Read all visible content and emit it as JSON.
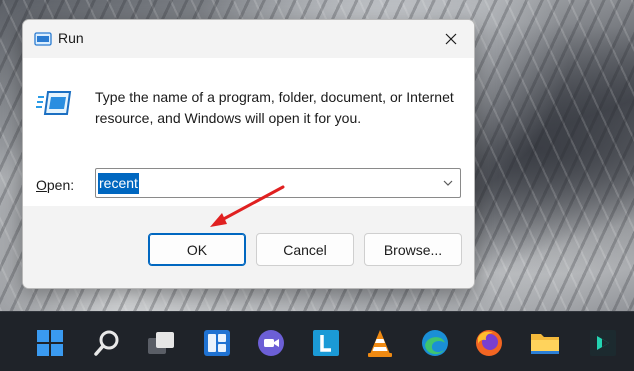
{
  "dialog": {
    "title": "Run",
    "description": "Type the name of a program, folder, document, or Internet resource, and Windows will open it for you.",
    "open_label_first": "O",
    "open_label_rest": "pen:",
    "input_value": "recent",
    "buttons": {
      "ok": "OK",
      "cancel": "Cancel",
      "browse": "Browse..."
    }
  },
  "taskbar": {
    "items": [
      {
        "icon": "windows-start-icon"
      },
      {
        "icon": "search-icon"
      },
      {
        "icon": "task-view-icon"
      },
      {
        "icon": "widgets-icon"
      },
      {
        "icon": "teams-chat-icon"
      },
      {
        "icon": "app-l-icon"
      },
      {
        "icon": "vlc-icon"
      },
      {
        "icon": "edge-icon"
      },
      {
        "icon": "firefox-icon"
      },
      {
        "icon": "file-explorer-icon"
      },
      {
        "icon": "filmora-icon"
      }
    ]
  },
  "colors": {
    "accent": "#0067c0",
    "annotation_arrow": "#e02020",
    "taskbar": "#1f2329"
  }
}
